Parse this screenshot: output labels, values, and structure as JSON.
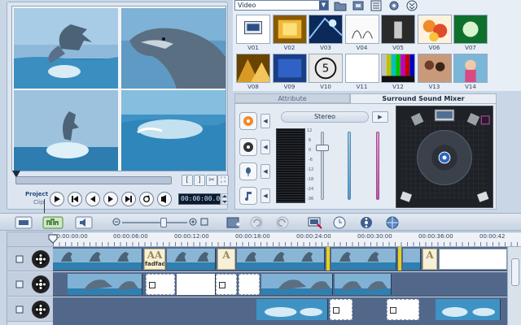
{
  "preview": {
    "mode_project": "Project",
    "mode_clip": "Clip",
    "timecode": "00:00:00.00",
    "mark_in": "[",
    "mark_out": "]"
  },
  "library": {
    "category": "Video",
    "thumbs": [
      {
        "label": "V01",
        "kind": "screen"
      },
      {
        "label": "V02",
        "kind": "gold"
      },
      {
        "label": "V03",
        "kind": "blue"
      },
      {
        "label": "V04",
        "kind": "flowers"
      },
      {
        "label": "V05",
        "kind": "dark"
      },
      {
        "label": "V06",
        "kind": "orange"
      },
      {
        "label": "V07",
        "kind": "green"
      },
      {
        "label": "V08",
        "kind": "gold2"
      },
      {
        "label": "V09",
        "kind": "blue2"
      },
      {
        "label": "V10",
        "kind": "countdown"
      },
      {
        "label": "V11",
        "kind": "white"
      },
      {
        "label": "V12",
        "kind": "bars"
      },
      {
        "label": "V13",
        "kind": "people"
      },
      {
        "label": "V14",
        "kind": "girl"
      }
    ]
  },
  "mixer": {
    "tab_attribute": "Attribute",
    "tab_surround": "Surround Sound Mixer",
    "channel_label": "Stereo",
    "scale": [
      "12",
      "6",
      "0",
      "-6",
      "-12",
      "-18",
      "-24",
      "-36"
    ]
  },
  "timeline": {
    "ruler": [
      "00:00:00:00",
      "00:00:06:00",
      "00:00:12:00",
      "00:00:18:00",
      "00:00:24:00",
      "00:00:30:00",
      "00:00:36:00",
      "00:00:42"
    ],
    "title_clip_text": "fadfad"
  },
  "colors": {
    "accent": "#3f5f8e",
    "track_bg": "#52688a",
    "marker": "#e8cf1a"
  }
}
